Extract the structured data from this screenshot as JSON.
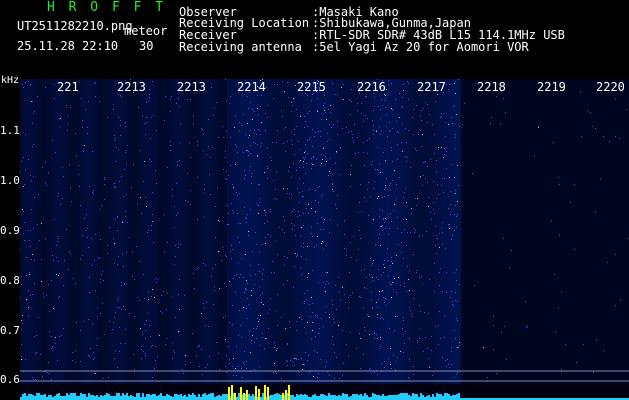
{
  "header": {
    "brand": "H R O F F T",
    "filename": "UT2511282210.png",
    "product": "meteor",
    "datetime": "25.11.28 22:10",
    "interval": "30"
  },
  "info": [
    {
      "label": "Observer",
      "value": ":Masaki Kano"
    },
    {
      "label": "Receiving Location",
      "value": ":Shibukawa,Gunma,Japan"
    },
    {
      "label": "Receiver",
      "value": ":RTL-SDR SDR# 43dB L15 114.1MHz USB"
    },
    {
      "label": "Receiving antenna",
      "value": ":5el Yagi Az 20 for Aomori VOR"
    }
  ],
  "axis": {
    "unit": "kHz",
    "y_ticks": [
      "1.1",
      "1.0",
      "0.9",
      "0.8",
      "0.7",
      "0.6"
    ],
    "x_ticks": [
      "221",
      "2213",
      "2213",
      "2214",
      "2215",
      "2216",
      "2217",
      "2218",
      "2219",
      "2220"
    ]
  },
  "colors": {
    "background": "#000000",
    "signal_low": "#0a1a8c",
    "signal_high": "#33ffee",
    "text": "#ffffff",
    "brand": "#22ee22",
    "baseline_bar": "#22ccff",
    "peak_bar": "#ffff00"
  }
}
